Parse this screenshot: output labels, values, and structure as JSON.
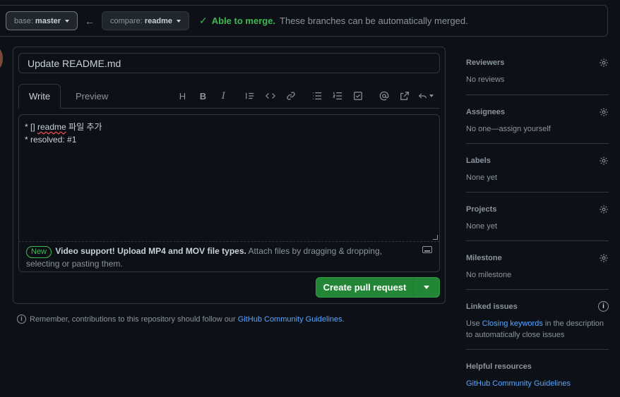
{
  "compare_bar": {
    "base_prefix": "base:",
    "base_branch": "master",
    "compare_prefix": "compare:",
    "compare_branch": "readme",
    "merge_ok": "Able to merge.",
    "merge_desc": "These branches can be automatically merged."
  },
  "pr": {
    "title_value": "Update README.md",
    "tabs": [
      "Write",
      "Preview"
    ],
    "body_line1_pre": "* [] ",
    "body_line1_word": "readme",
    "body_line1_post": " 파일 추가",
    "body_line2": "* resolved: #1",
    "attach_badge": "New",
    "attach_bold": "Video support! Upload MP4 and MOV file types.",
    "attach_text": " Attach files by dragging & dropping, selecting or pasting them.",
    "create_label": "Create pull request"
  },
  "remember": {
    "text": "Remember, contributions to this repository should follow our ",
    "link": "GitHub Community Guidelines",
    "suffix": "."
  },
  "sidebar": {
    "reviewers": {
      "title": "Reviewers",
      "value": "No reviews"
    },
    "assignees": {
      "title": "Assignees",
      "value": "No one—assign yourself"
    },
    "labels": {
      "title": "Labels",
      "value": "None yet"
    },
    "projects": {
      "title": "Projects",
      "value": "None yet"
    },
    "milestone": {
      "title": "Milestone",
      "value": "No milestone"
    },
    "linked_issues": {
      "title": "Linked issues",
      "pre": "Use ",
      "link": "Closing keywords",
      "post": " in the description to automatically close issues"
    },
    "helpful": {
      "title": "Helpful resources",
      "link": "GitHub Community Guidelines"
    }
  },
  "icons": {
    "toolbar": [
      "heading-icon",
      "bold-icon",
      "italic-icon",
      "quote-icon",
      "code-icon",
      "link-icon",
      "bulleted-list-icon",
      "numbered-list-icon",
      "task-list-icon",
      "mention-icon",
      "cross-reference-icon",
      "reply-icon"
    ]
  },
  "colors": {
    "background": "#0d1117",
    "border": "#30363d",
    "success": "#3fb950",
    "primary_button": "#238636",
    "link": "#58a6ff",
    "muted": "#8b949e"
  }
}
